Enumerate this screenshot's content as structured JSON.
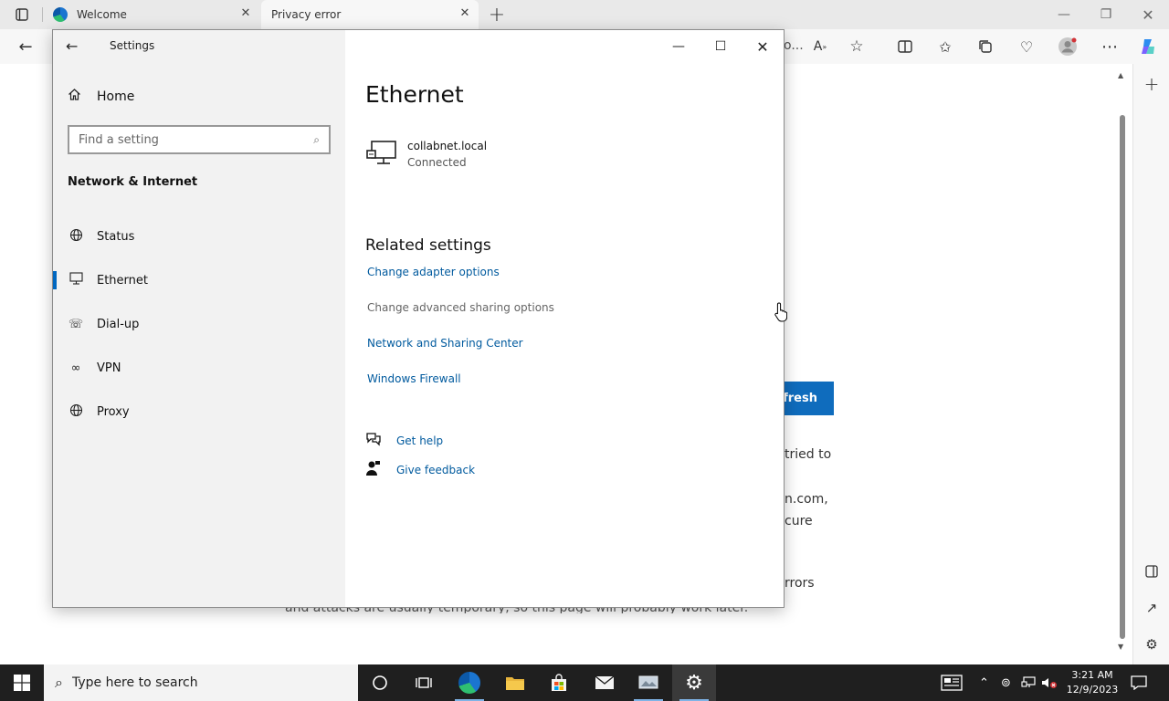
{
  "browser": {
    "tabs": [
      {
        "label": "Welcome"
      },
      {
        "label": "Privacy error"
      }
    ],
    "address_fragment": "o..."
  },
  "background_page": {
    "refresh_label": "efresh",
    "fragments": [
      "tried to",
      "n.com,",
      "cure",
      "rrors",
      "and attacks are usually temporary, so this page will probably work later."
    ]
  },
  "settings": {
    "window_title": "Settings",
    "home_label": "Home",
    "search_placeholder": "Find a setting",
    "section_title": "Network & Internet",
    "nav": [
      {
        "label": "Status",
        "icon": "globe-icon"
      },
      {
        "label": "Ethernet",
        "icon": "monitor-icon",
        "active": true
      },
      {
        "label": "Dial-up",
        "icon": "phone-icon"
      },
      {
        "label": "VPN",
        "icon": "vpn-icon"
      },
      {
        "label": "Proxy",
        "icon": "globe-icon"
      }
    ],
    "heading": "Ethernet",
    "network": {
      "name": "collabnet.local",
      "status": "Connected"
    },
    "related_title": "Related settings",
    "links": [
      "Change adapter options",
      "Change advanced sharing options",
      "Network and Sharing Center",
      "Windows Firewall"
    ],
    "help": [
      {
        "label": "Get help",
        "icon": "help-chat-icon"
      },
      {
        "label": "Give feedback",
        "icon": "feedback-icon"
      }
    ]
  },
  "taskbar": {
    "search_placeholder": "Type here to search",
    "time": "3:21 AM",
    "date": "12/9/2023"
  },
  "colors": {
    "accent": "#0067c0",
    "link": "#005a9e",
    "taskbar": "#1f1f1f"
  }
}
